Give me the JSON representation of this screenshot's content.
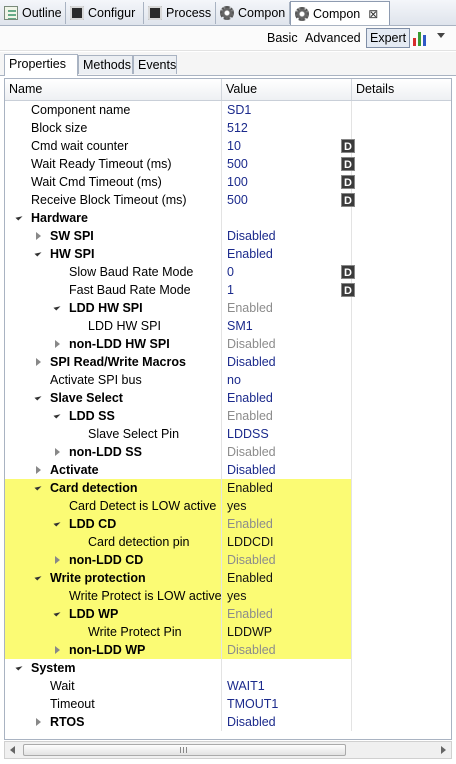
{
  "view_tabs": [
    {
      "label": "Outline",
      "icon": "outline-icon"
    },
    {
      "label": "Configur",
      "icon": "chip-icon"
    },
    {
      "label": "Process",
      "icon": "chip-icon"
    },
    {
      "label": "Compon",
      "icon": "gear-icon"
    },
    {
      "label": "Compon",
      "icon": "gear-icon",
      "close": "⊠"
    }
  ],
  "toolbar": {
    "basic": "Basic",
    "advanced": "Advanced",
    "expert": "Expert",
    "colors": {
      "bar1": "#d62d2d",
      "bar2": "#3a9a32",
      "bar3": "#2f59c6"
    }
  },
  "inner_tabs": [
    "Properties",
    "Methods",
    "Events"
  ],
  "columns": {
    "name": "Name",
    "value": "Value",
    "details": "Details"
  },
  "rows": [
    {
      "name": "Component name",
      "value": "SD1",
      "d": false
    },
    {
      "name": "Block size",
      "value": "512",
      "d": false
    },
    {
      "name": "Cmd wait counter",
      "value": "10",
      "d": "D"
    },
    {
      "name": "Wait Ready Timeout (ms)",
      "value": "500",
      "d": "D"
    },
    {
      "name": "Wait Cmd Timeout (ms)",
      "value": "100",
      "d": "D"
    },
    {
      "name": "Receive Block Timeout (ms)",
      "value": "500",
      "d": "D"
    },
    {
      "name": "Hardware",
      "value": ""
    },
    {
      "name": "SW SPI",
      "value": "Disabled"
    },
    {
      "name": "HW SPI",
      "value": "Enabled"
    },
    {
      "name": "Slow Baud Rate Mode",
      "value": "0",
      "d": "D"
    },
    {
      "name": "Fast Baud Rate Mode",
      "value": "1",
      "d": "D"
    },
    {
      "name": "LDD HW SPI",
      "value": "Enabled"
    },
    {
      "name": "LDD HW SPI",
      "value": "SM1"
    },
    {
      "name": "non-LDD HW SPI",
      "value": "Disabled"
    },
    {
      "name": "SPI Read/Write Macros",
      "value": "Disabled"
    },
    {
      "name": "Activate SPI bus",
      "value": "no"
    },
    {
      "name": "Slave Select",
      "value": "Enabled"
    },
    {
      "name": "LDD SS",
      "value": "Enabled"
    },
    {
      "name": "Slave Select Pin",
      "value": "LDDSS"
    },
    {
      "name": "non-LDD SS",
      "value": "Disabled"
    },
    {
      "name": "Activate",
      "value": "Disabled"
    },
    {
      "name": "Card detection",
      "value": "Enabled"
    },
    {
      "name": "Card Detect is LOW active",
      "value": "yes"
    },
    {
      "name": "LDD CD",
      "value": "Enabled"
    },
    {
      "name": "Card detection pin",
      "value": "LDDCDI"
    },
    {
      "name": "non-LDD CD",
      "value": "Disabled"
    },
    {
      "name": "Write protection",
      "value": "Enabled"
    },
    {
      "name": "Write Protect is LOW active",
      "value": "yes"
    },
    {
      "name": "LDD WP",
      "value": "Enabled"
    },
    {
      "name": "Write Protect Pin",
      "value": "LDDWP"
    },
    {
      "name": "non-LDD WP",
      "value": "Disabled"
    },
    {
      "name": "System",
      "value": ""
    },
    {
      "name": "Wait",
      "value": "WAIT1"
    },
    {
      "name": "Timeout",
      "value": "TMOUT1"
    },
    {
      "name": "RTOS",
      "value": "Disabled"
    }
  ],
  "highlight_color": "#fbfb74"
}
